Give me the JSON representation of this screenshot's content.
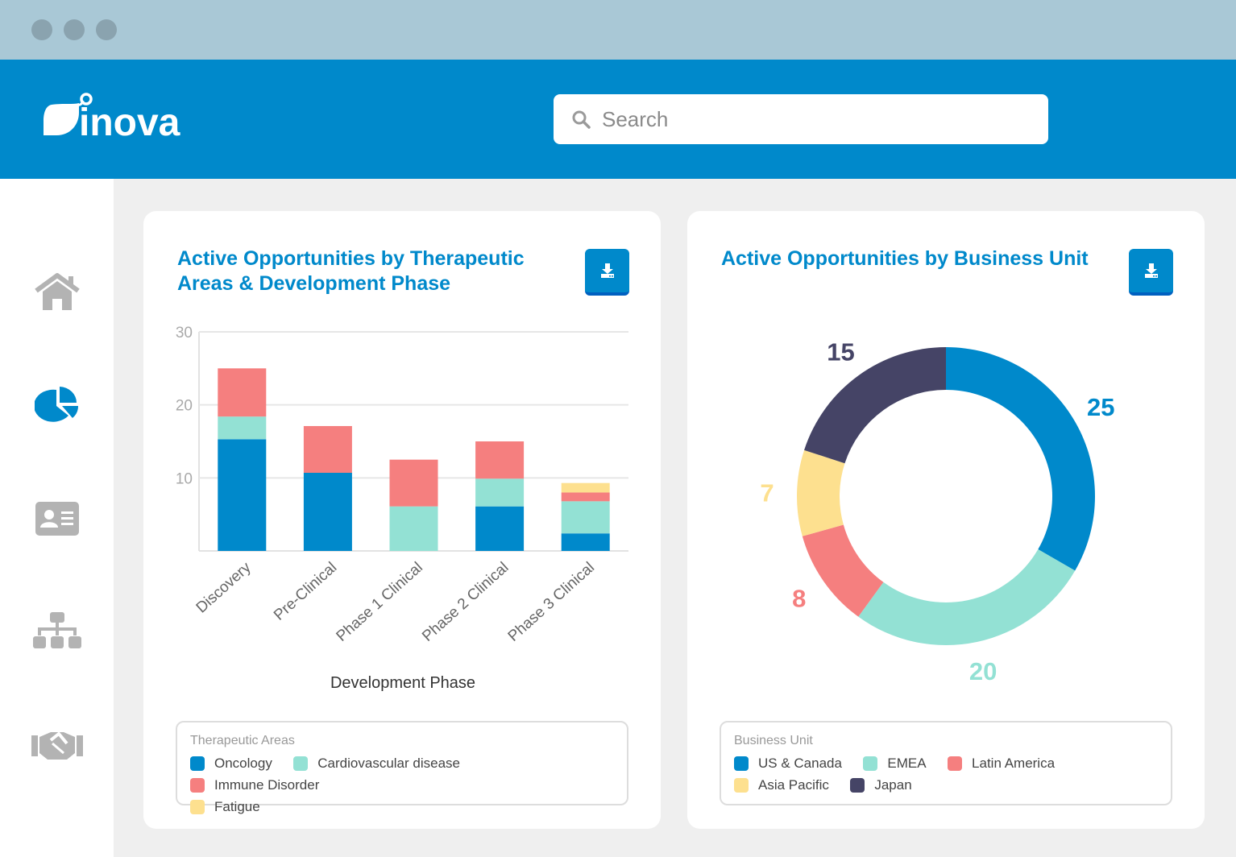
{
  "brand": {
    "logo_text": "inova"
  },
  "search": {
    "placeholder": "Search"
  },
  "sidebar": {
    "items": [
      {
        "name": "home",
        "icon": "home-icon",
        "active": false
      },
      {
        "name": "analytics",
        "icon": "pie-chart-icon",
        "active": true
      },
      {
        "name": "contacts",
        "icon": "id-card-icon",
        "active": false
      },
      {
        "name": "organization",
        "icon": "org-chart-icon",
        "active": false
      },
      {
        "name": "partnerships",
        "icon": "handshake-icon",
        "active": false
      }
    ]
  },
  "colors": {
    "accent": "#0089cb",
    "oncology": "#0089cb",
    "cardio": "#93e1d4",
    "immune": "#f57f7f",
    "fatigue": "#fde08f",
    "japan": "#454466"
  },
  "card1": {
    "title_line1": "Active Opportunities by Therapeutic",
    "title_line2": "Areas & Development Phase",
    "download_icon": "download-icon",
    "legend_title": "Therapeutic Areas",
    "legend": [
      "Oncology",
      "Cardiovascular disease",
      "Immune Disorder",
      "Fatigue"
    ]
  },
  "card2": {
    "title": "Active Opportunities by Business Unit",
    "download_icon": "download-icon",
    "legend_title": "Business Unit",
    "legend": [
      "US & Canada",
      "EMEA",
      "Latin America",
      "Asia Pacific",
      "Japan"
    ]
  },
  "chart_data": [
    {
      "type": "bar",
      "stacked": true,
      "title": "Active Opportunities by Therapeutic Areas & Development Phase",
      "xlabel": "Development Phase",
      "ylabel": "",
      "ylim": [
        0,
        30
      ],
      "yticks": [
        "10",
        "20",
        "30"
      ],
      "grid": true,
      "categories": [
        "Discovery",
        "Pre-Clinical",
        "Phase 1 Clinical",
        "Phase 2 Clinical",
        "Phase 3 Clinical"
      ],
      "series": [
        {
          "name": "Oncology",
          "color": "#0089cb",
          "values": [
            15.3,
            10.7,
            0,
            6.1,
            2.4
          ]
        },
        {
          "name": "Cardiovascular disease",
          "color": "#93e1d4",
          "values": [
            3.1,
            0,
            6.1,
            3.8,
            4.4
          ]
        },
        {
          "name": "Immune Disorder",
          "color": "#f57f7f",
          "values": [
            6.6,
            6.4,
            6.4,
            5.1,
            1.2
          ]
        },
        {
          "name": "Fatigue",
          "color": "#fde08f",
          "values": [
            0,
            0,
            0,
            0,
            1.3
          ]
        }
      ],
      "legend": "bottom"
    },
    {
      "type": "pie",
      "donut": true,
      "title": "Active Opportunities by Business Unit",
      "slices": [
        {
          "name": "US & Canada",
          "value": 25,
          "label": "25",
          "color": "#0089cb"
        },
        {
          "name": "EMEA",
          "value": 20,
          "label": "20",
          "color": "#93e1d4"
        },
        {
          "name": "Latin America",
          "value": 8,
          "label": "8",
          "color": "#f57f7f"
        },
        {
          "name": "Asia Pacific",
          "value": 7,
          "label": "7",
          "color": "#fde08f"
        },
        {
          "name": "Japan",
          "value": 15,
          "label": "15",
          "color": "#454466"
        }
      ],
      "legend": "bottom"
    }
  ]
}
